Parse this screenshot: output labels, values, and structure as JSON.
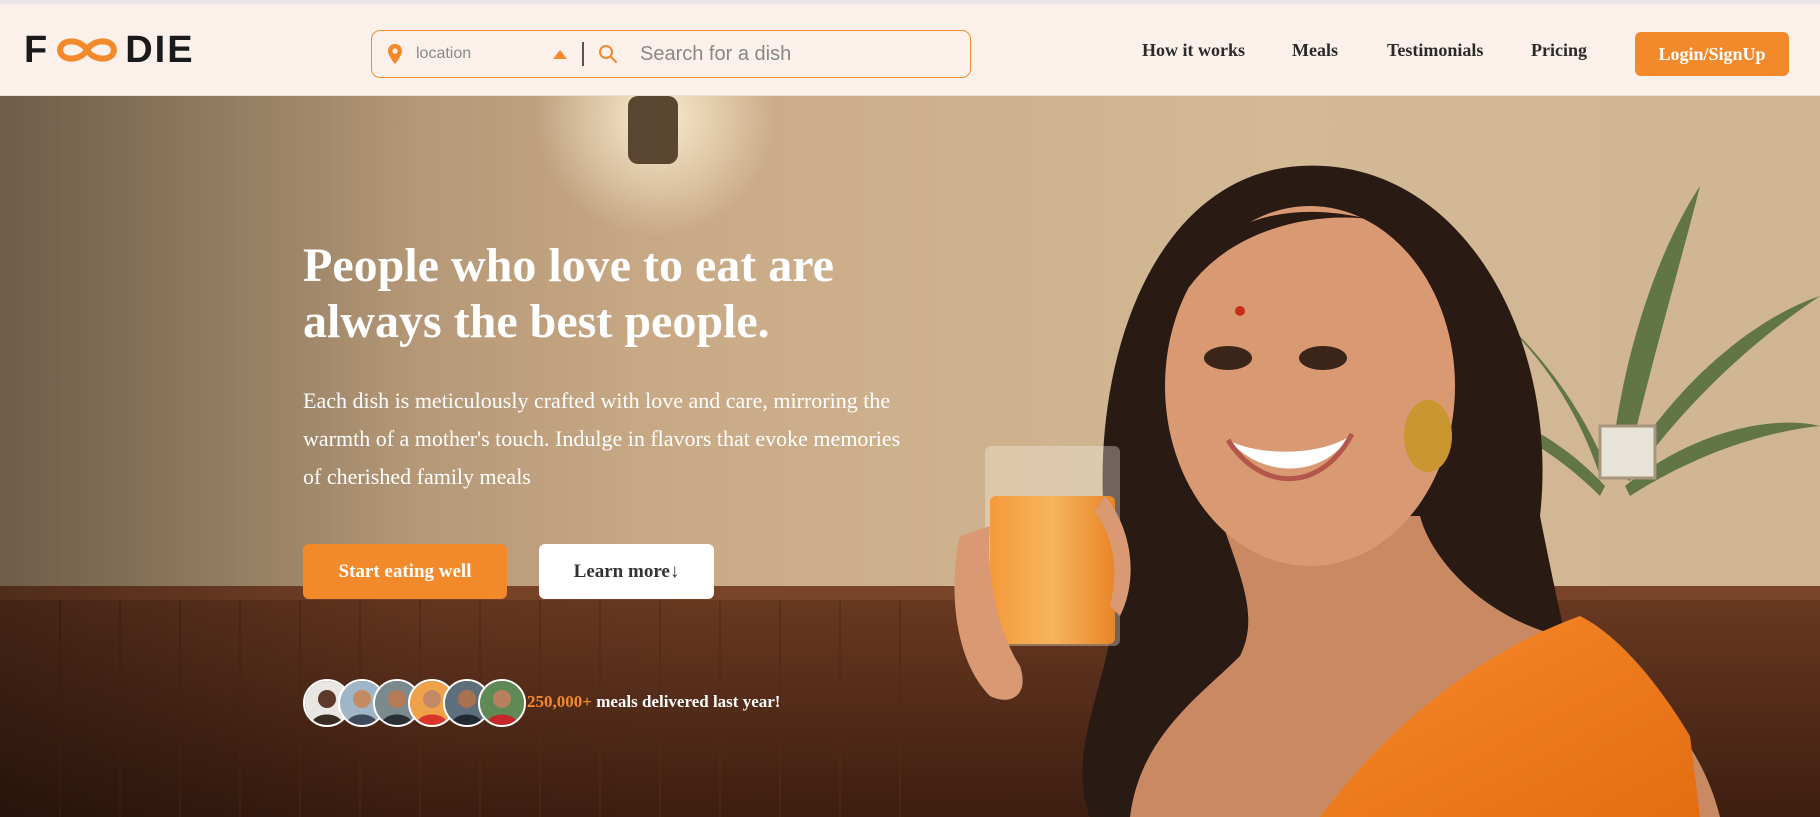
{
  "brand": {
    "logo_prefix": "F",
    "logo_suffix": "DIE",
    "accent_color": "#f28a2c"
  },
  "search": {
    "location_placeholder": "location",
    "dish_placeholder": "Search for a dish"
  },
  "nav": {
    "items": [
      "How it works",
      "Meals",
      "Testimonials",
      "Pricing"
    ],
    "login_label": "Login/SignUp"
  },
  "hero": {
    "headline": "People who love to eat are always the best people.",
    "subcopy": "Each dish is meticulously crafted with love and care, mirroring the warmth of a mother's touch. Indulge in flavors that evoke memories of cherished family meals",
    "primary_button": "Start eating well",
    "secondary_button": "Learn more↓",
    "stat_number": "250,000+",
    "stat_text": " meals delivered last year!"
  },
  "icons": [
    "location-pin-icon",
    "caret-up-icon",
    "search-icon",
    "infinity-icon"
  ]
}
